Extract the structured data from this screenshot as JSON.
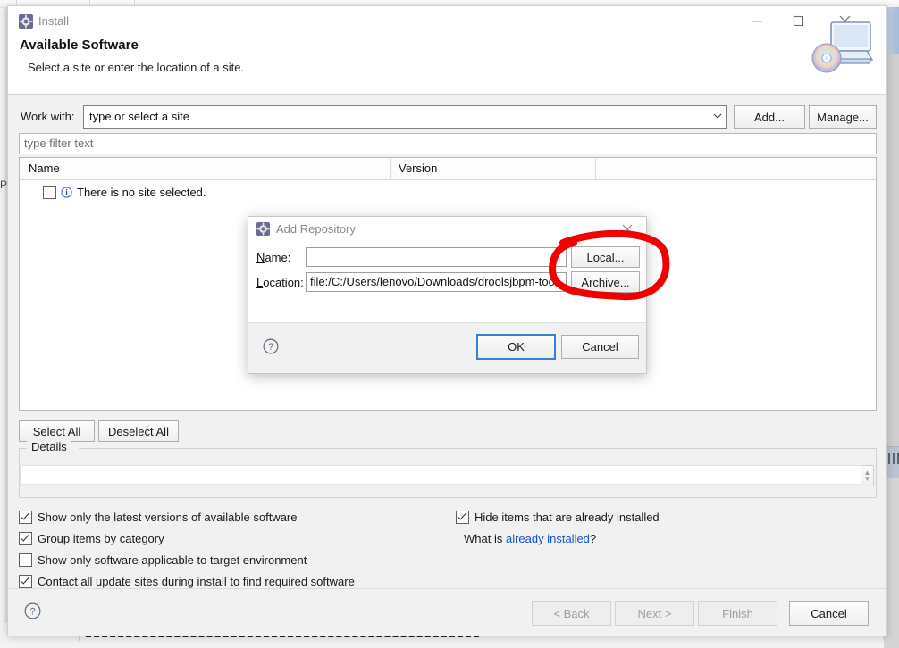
{
  "window": {
    "title": "Install",
    "title_icon": "install-icon",
    "minimize_label": "Minimize",
    "maximize_label": "Maximize",
    "close_label": "Close"
  },
  "header": {
    "title": "Available Software",
    "subtitle": "Select a site or enter the location of a site.",
    "artwork_icon": "software-install-artwork"
  },
  "work_with": {
    "label": "Work with:",
    "value": "type or select a site",
    "add_label": "Add...",
    "manage_label": "Manage..."
  },
  "filter": {
    "placeholder": "type filter text",
    "value": ""
  },
  "table": {
    "columns": [
      "Name",
      "Version",
      ""
    ],
    "rows": [
      {
        "checked": false,
        "icon": "info-icon",
        "name": "There is no site selected.",
        "version": ""
      }
    ]
  },
  "selection_buttons": {
    "select_all": "Select All",
    "deselect_all": "Deselect All"
  },
  "details": {
    "legend": "Details",
    "value": ""
  },
  "options": {
    "left": [
      {
        "label": "Show only the latest versions of available software",
        "checked": true
      },
      {
        "label": "Group items by category",
        "checked": true
      },
      {
        "label": "Show only software applicable to target environment",
        "checked": false
      },
      {
        "label": "Contact all update sites during install to find required software",
        "checked": true
      }
    ],
    "right": [
      {
        "label": "Hide items that are already installed",
        "checked": true
      }
    ],
    "what_is_prefix": "What is ",
    "what_is_link": "already installed",
    "what_is_suffix": "?"
  },
  "footer": {
    "help_icon": "help-icon",
    "back": "< Back",
    "next": "Next >",
    "finish": "Finish",
    "cancel": "Cancel"
  },
  "add_repository": {
    "title": "Add Repository",
    "title_icon": "install-icon",
    "close_label": "Close",
    "name_label": "Name:",
    "name_value": "",
    "location_label": "Location:",
    "location_value": "file:/C:/Users/lenovo/Downloads/droolsjbpm-too",
    "local_label": "Local...",
    "archive_label": "Archive...",
    "help_icon": "help-icon",
    "ok_label": "OK",
    "cancel_label": "Cancel"
  },
  "annotation": {
    "shape": "red-ellipse-highlight",
    "color": "#f20000",
    "targets": "Local... button"
  },
  "backdrop": {
    "left_label": "P"
  },
  "colors": {
    "accent": "#3a7fd5",
    "link": "#1155cc",
    "annotation_red": "#f20000",
    "window_bg": "#f1f1f1",
    "field_bg": "#ffffff"
  }
}
